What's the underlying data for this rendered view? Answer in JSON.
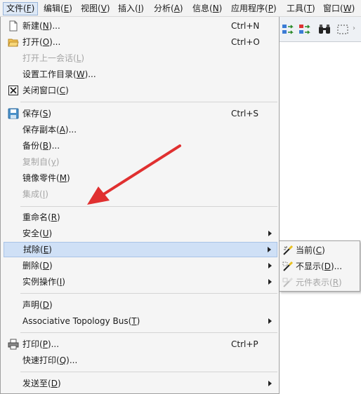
{
  "menubar": [
    {
      "label": "文件(",
      "key": "F",
      "tail": ")",
      "active": true
    },
    {
      "label": "编辑(",
      "key": "E",
      "tail": ")"
    },
    {
      "label": "视图(",
      "key": "V",
      "tail": ")"
    },
    {
      "label": "插入(",
      "key": "I",
      "tail": ")"
    },
    {
      "label": "分析(",
      "key": "A",
      "tail": ")"
    },
    {
      "label": "信息(",
      "key": "N",
      "tail": ")"
    },
    {
      "label": "应用程序(",
      "key": "P",
      "tail": ")"
    },
    {
      "label": "工具(",
      "key": "T",
      "tail": ")"
    },
    {
      "label": "窗口(",
      "key": "W",
      "tail": ")"
    }
  ],
  "file_menu": {
    "new": {
      "label": "新建(",
      "key": "N",
      "tail": ")...",
      "shortcut": "Ctrl+N",
      "icon": "new-document-icon"
    },
    "open": {
      "label": "打开(",
      "key": "O",
      "tail": ")...",
      "shortcut": "Ctrl+O",
      "icon": "open-folder-icon"
    },
    "open_last_session": {
      "label": "打开上一会话(",
      "key": "L",
      "tail": ")"
    },
    "set_working_dir": {
      "label": "设置工作目录(",
      "key": "W",
      "tail": ")..."
    },
    "close_window": {
      "label": "关闭窗口(",
      "key": "C",
      "tail": ")",
      "icon": "close-window-icon"
    },
    "save": {
      "label": "保存(",
      "key": "S",
      "tail": ")",
      "shortcut": "Ctrl+S",
      "icon": "save-icon"
    },
    "save_copy": {
      "label": "保存副本(",
      "key": "A",
      "tail": ")..."
    },
    "backup": {
      "label": "备份(",
      "key": "B",
      "tail": ")..."
    },
    "copy_from": {
      "label": "复制自(",
      "key": "y",
      "tail": ")"
    },
    "mirror_part": {
      "label": "镜像零件(",
      "key": "M",
      "tail": ")"
    },
    "integrate": {
      "label": "集成(",
      "key": "I",
      "tail": ")"
    },
    "rename": {
      "label": "重命名(",
      "key": "R",
      "tail": ")"
    },
    "security": {
      "label": "安全(",
      "key": "U",
      "tail": ")"
    },
    "erase": {
      "label": "拭除(",
      "key": "E",
      "tail": ")"
    },
    "delete": {
      "label": "删除(",
      "key": "D",
      "tail": ")"
    },
    "instance_ops": {
      "label": "实例操作(",
      "key": "I",
      "tail": ")"
    },
    "declare": {
      "label": "声明(",
      "key": "D",
      "tail": ")"
    },
    "atb": {
      "label": "Associative Topology Bus(",
      "key": "T",
      "tail": ")"
    },
    "print": {
      "label": "打印(",
      "key": "P",
      "tail": ")...",
      "shortcut": "Ctrl+P",
      "icon": "printer-icon"
    },
    "quick_print": {
      "label": "快速打印(",
      "key": "Q",
      "tail": ")..."
    },
    "send_to": {
      "label": "发送至(",
      "key": "D",
      "tail": ")"
    }
  },
  "erase_submenu": {
    "current": {
      "label": "当前(",
      "key": "C",
      "tail": ")",
      "icon": "erase-current-icon"
    },
    "not_displayed": {
      "label": "不显示(",
      "key": "D",
      "tail": ")...",
      "icon": "erase-not-displayed-icon"
    },
    "element_display": {
      "label": "元件表示(",
      "key": "R",
      "tail": ")",
      "icon": "erase-element-icon"
    }
  },
  "colors": {
    "highlight": "#cfe0f6",
    "annotation_arrow": "#e03030",
    "disabled_text": "#a6a6a6"
  }
}
